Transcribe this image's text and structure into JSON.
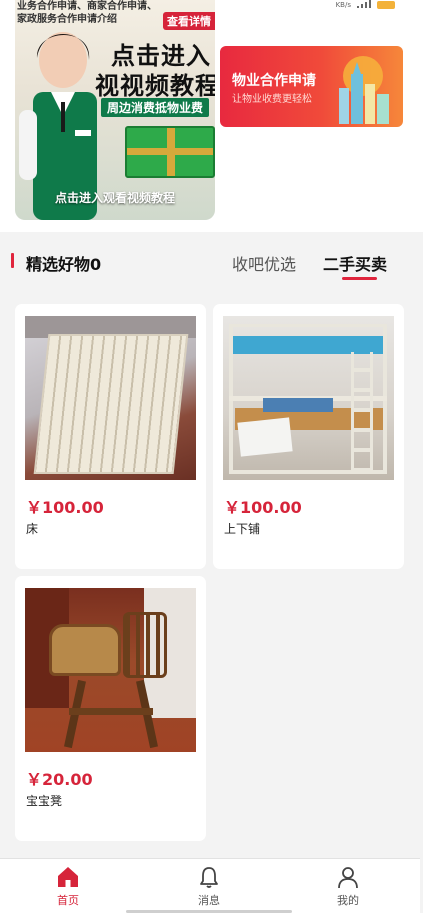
{
  "banner": {
    "top_line_1": "业务合作申请、商家合作申请、",
    "top_line_2": "家政服务合作申请介绍",
    "detail_button": "查看详情",
    "title_line_1": "点击进入",
    "title_line_2": "视视频教程",
    "subtitle": "周边消费抵物业费",
    "caption": "点击进入观看视频教程"
  },
  "status_bar": {
    "network_speed": "KB/s"
  },
  "coop_card": {
    "title": "物业合作申请",
    "subtitle": "让物业收费更轻松"
  },
  "section": {
    "title": "精选好物0",
    "tabs": [
      {
        "label": "收吧优选",
        "active": false
      },
      {
        "label": "二手买卖",
        "active": true
      }
    ],
    "accent_color": "#e0253d"
  },
  "products": [
    {
      "price": "￥100.00",
      "name": "床"
    },
    {
      "price": "￥100.00",
      "name": "上下铺"
    },
    {
      "price": "￥20.00",
      "name": "宝宝凳"
    }
  ],
  "bottom_nav": [
    {
      "label": "首页",
      "icon": "home-icon",
      "active": true
    },
    {
      "label": "消息",
      "icon": "bell-icon",
      "active": false
    },
    {
      "label": "我的",
      "icon": "user-icon",
      "active": false
    }
  ],
  "colors": {
    "price": "#d6243a",
    "brand_red": "#e0253d",
    "active_nav": "#d6243a"
  }
}
